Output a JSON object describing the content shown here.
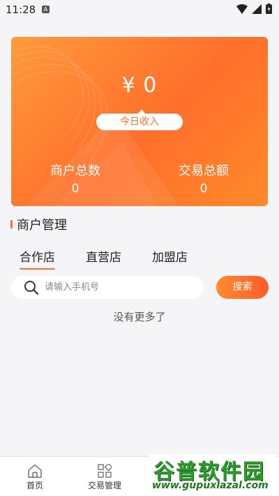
{
  "status_bar": {
    "time": "11:28",
    "a_badge": "A"
  },
  "summary_card": {
    "amount": "¥ 0",
    "today_income_label": "今日收入",
    "merchant_total_label": "商户总数",
    "merchant_total_value": "0",
    "transaction_total_label": "交易总额",
    "transaction_total_value": "0"
  },
  "section": {
    "title": "商户管理"
  },
  "tabs": [
    {
      "label": "合作店",
      "active": true
    },
    {
      "label": "直营店",
      "active": false
    },
    {
      "label": "加盟店",
      "active": false
    }
  ],
  "search": {
    "placeholder": "请输入手机号",
    "button_label": "搜索"
  },
  "list": {
    "empty_text": "没有更多了"
  },
  "bottom_nav": [
    {
      "label": "首页",
      "icon": "home-icon"
    },
    {
      "label": "交易管理",
      "icon": "grid-icon"
    }
  ],
  "watermark": {
    "title": "谷普软件园",
    "url": "www.gupuxlazal.com"
  },
  "colors": {
    "accent": "#ff6f2b",
    "background": "#f5f5f7"
  }
}
